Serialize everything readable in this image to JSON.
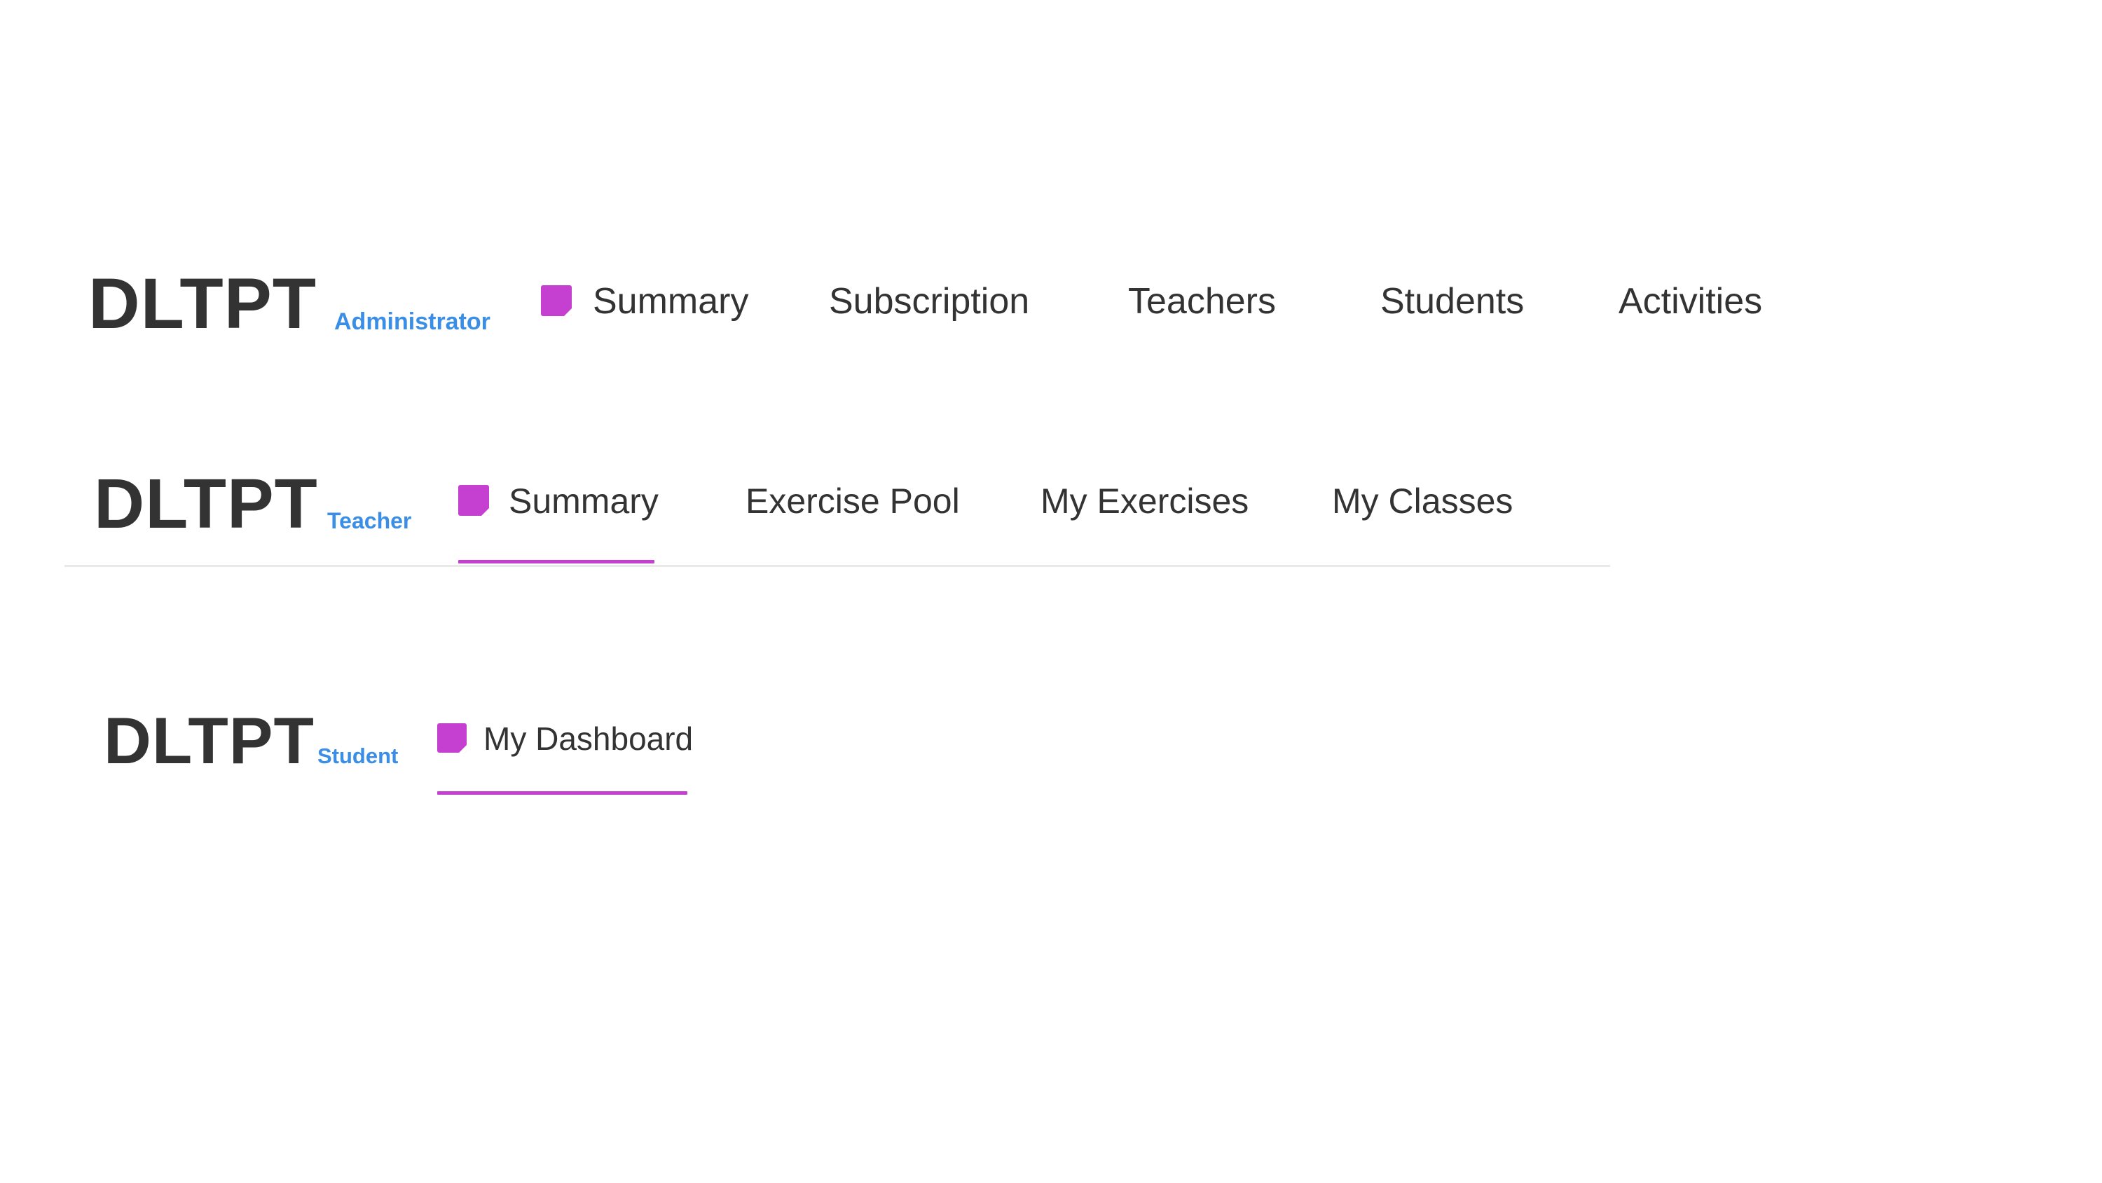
{
  "admin_bar": {
    "brand": "DLTPT",
    "role": "Administrator",
    "items": [
      {
        "label": "Summary",
        "icon": "note-icon"
      },
      {
        "label": "Subscription"
      },
      {
        "label": "Teachers"
      },
      {
        "label": "Students"
      },
      {
        "label": "Activities"
      }
    ]
  },
  "teacher_bar": {
    "brand": "DLTPT",
    "role": "Teacher",
    "active_item": "Summary",
    "items": [
      {
        "label": "Summary",
        "icon": "note-icon"
      },
      {
        "label": "Exercise Pool"
      },
      {
        "label": "My Exercises"
      },
      {
        "label": "My Classes"
      }
    ]
  },
  "student_bar": {
    "brand": "DLTPT",
    "role": "Student",
    "active_item": "My Dashboard",
    "items": [
      {
        "label": "My Dashboard",
        "icon": "note-icon"
      }
    ]
  },
  "colors": {
    "accent": "#c53fd0",
    "role_text": "#3a8ee6",
    "text": "#333333",
    "divider": "#e9e9e9"
  }
}
